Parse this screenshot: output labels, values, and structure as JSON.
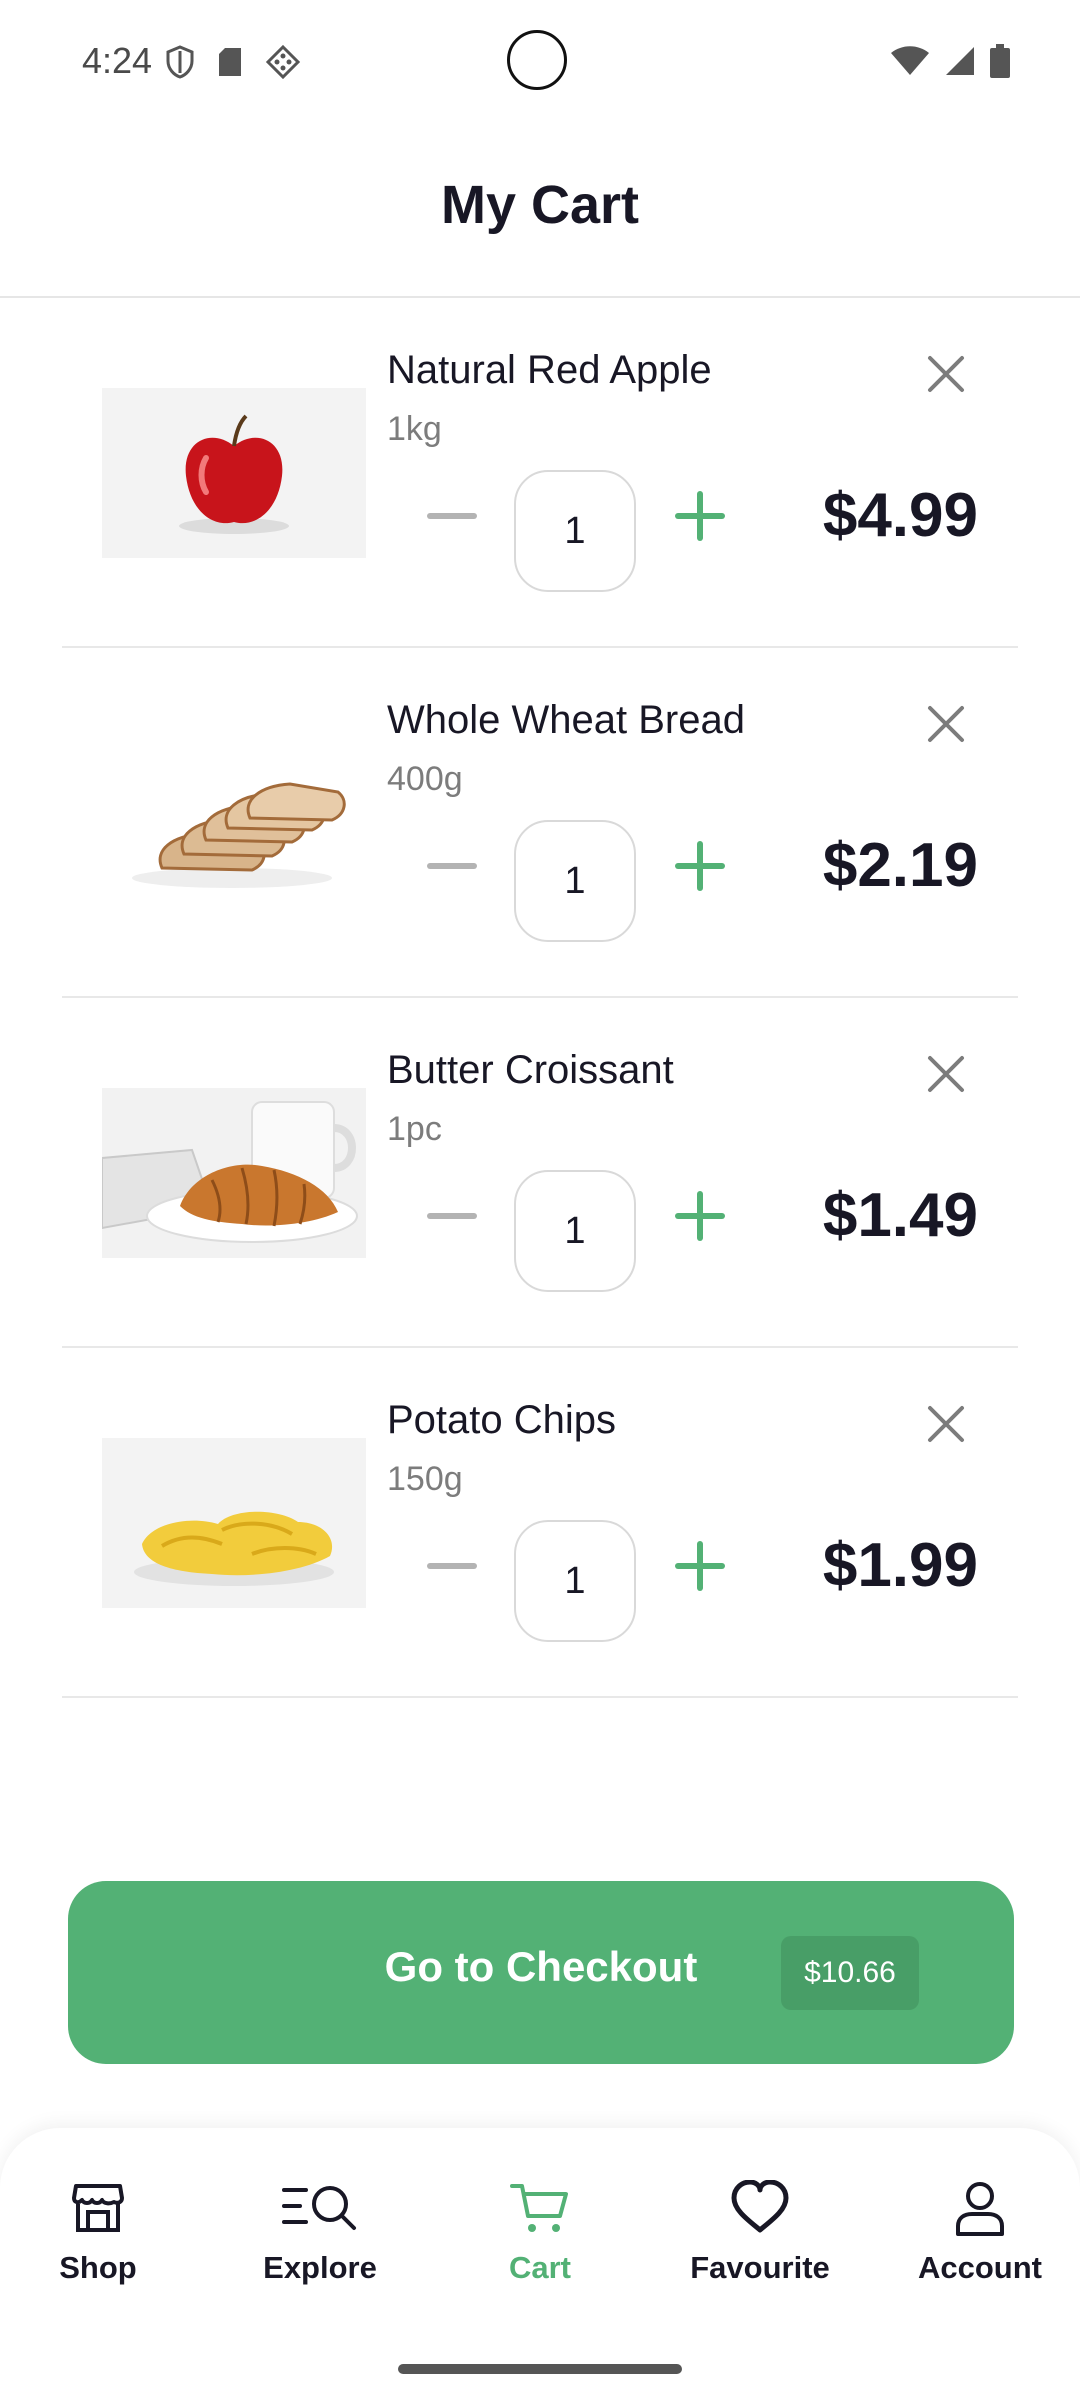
{
  "status_bar": {
    "time": "4:24"
  },
  "header": {
    "title": "My Cart"
  },
  "cart": {
    "items": [
      {
        "name": "Natural Red Apple",
        "unit": "1kg",
        "quantity": "1",
        "price": "$4.99",
        "image": "red-apple"
      },
      {
        "name": "Whole Wheat Bread",
        "unit": "400g",
        "quantity": "1",
        "price": "$2.19",
        "image": "bread-slices"
      },
      {
        "name": "Butter Croissant",
        "unit": "1pc",
        "quantity": "1",
        "price": "$1.49",
        "image": "croissant"
      },
      {
        "name": "Potato Chips",
        "unit": "150g",
        "quantity": "1",
        "price": "$1.99",
        "image": "potato-chips"
      }
    ]
  },
  "checkout": {
    "label": "Go to Checkout",
    "total": "$10.66"
  },
  "nav": {
    "items": [
      {
        "label": "Shop",
        "icon": "shop-icon"
      },
      {
        "label": "Explore",
        "icon": "explore-icon"
      },
      {
        "label": "Cart",
        "icon": "cart-icon",
        "active": true
      },
      {
        "label": "Favourite",
        "icon": "heart-icon"
      },
      {
        "label": "Account",
        "icon": "account-icon"
      }
    ]
  },
  "colors": {
    "accent": "#53b175",
    "text": "#181725",
    "muted": "#7c7c7c",
    "divider": "#e8e8e8"
  }
}
